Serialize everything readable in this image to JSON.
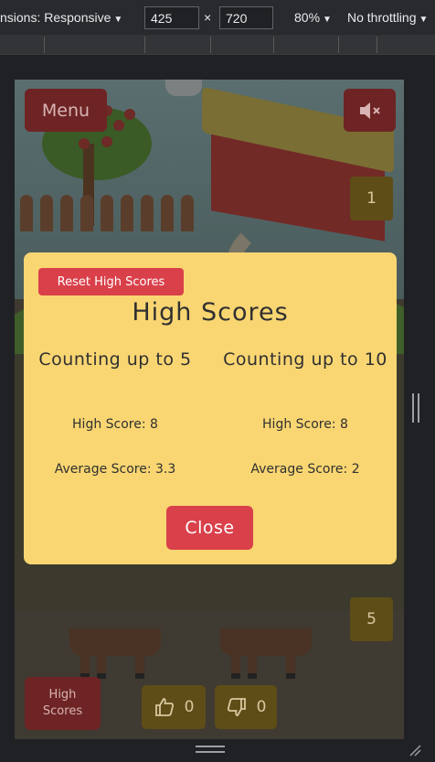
{
  "devtools": {
    "dimensions_label": "nsions: Responsive",
    "width_value": "425",
    "height_value": "720",
    "times": "×",
    "zoom": "80%",
    "throttling": "No throttling"
  },
  "game": {
    "menu_label": "Menu",
    "sound_icon": "mute-icon",
    "number_top": "1",
    "number_bottom": "5",
    "high_scores_button": "High\nScores",
    "thumbs_up_count": "0",
    "thumbs_down_count": "0"
  },
  "modal": {
    "reset_label": "Reset High Scores",
    "title": "High Scores",
    "columns": [
      {
        "title": "Counting up to 5",
        "high_score": "High Score: 8",
        "average_score": "Average Score: 3.3"
      },
      {
        "title": "Counting up to 10",
        "high_score": "High Score: 8",
        "average_score": "Average Score: 2"
      }
    ],
    "close_label": "Close"
  },
  "colors": {
    "modal_bg": "#f9d672",
    "button_red": "#d9404a",
    "overlay_menu": "#6e2424",
    "tile_dark": "#5e4d17"
  }
}
